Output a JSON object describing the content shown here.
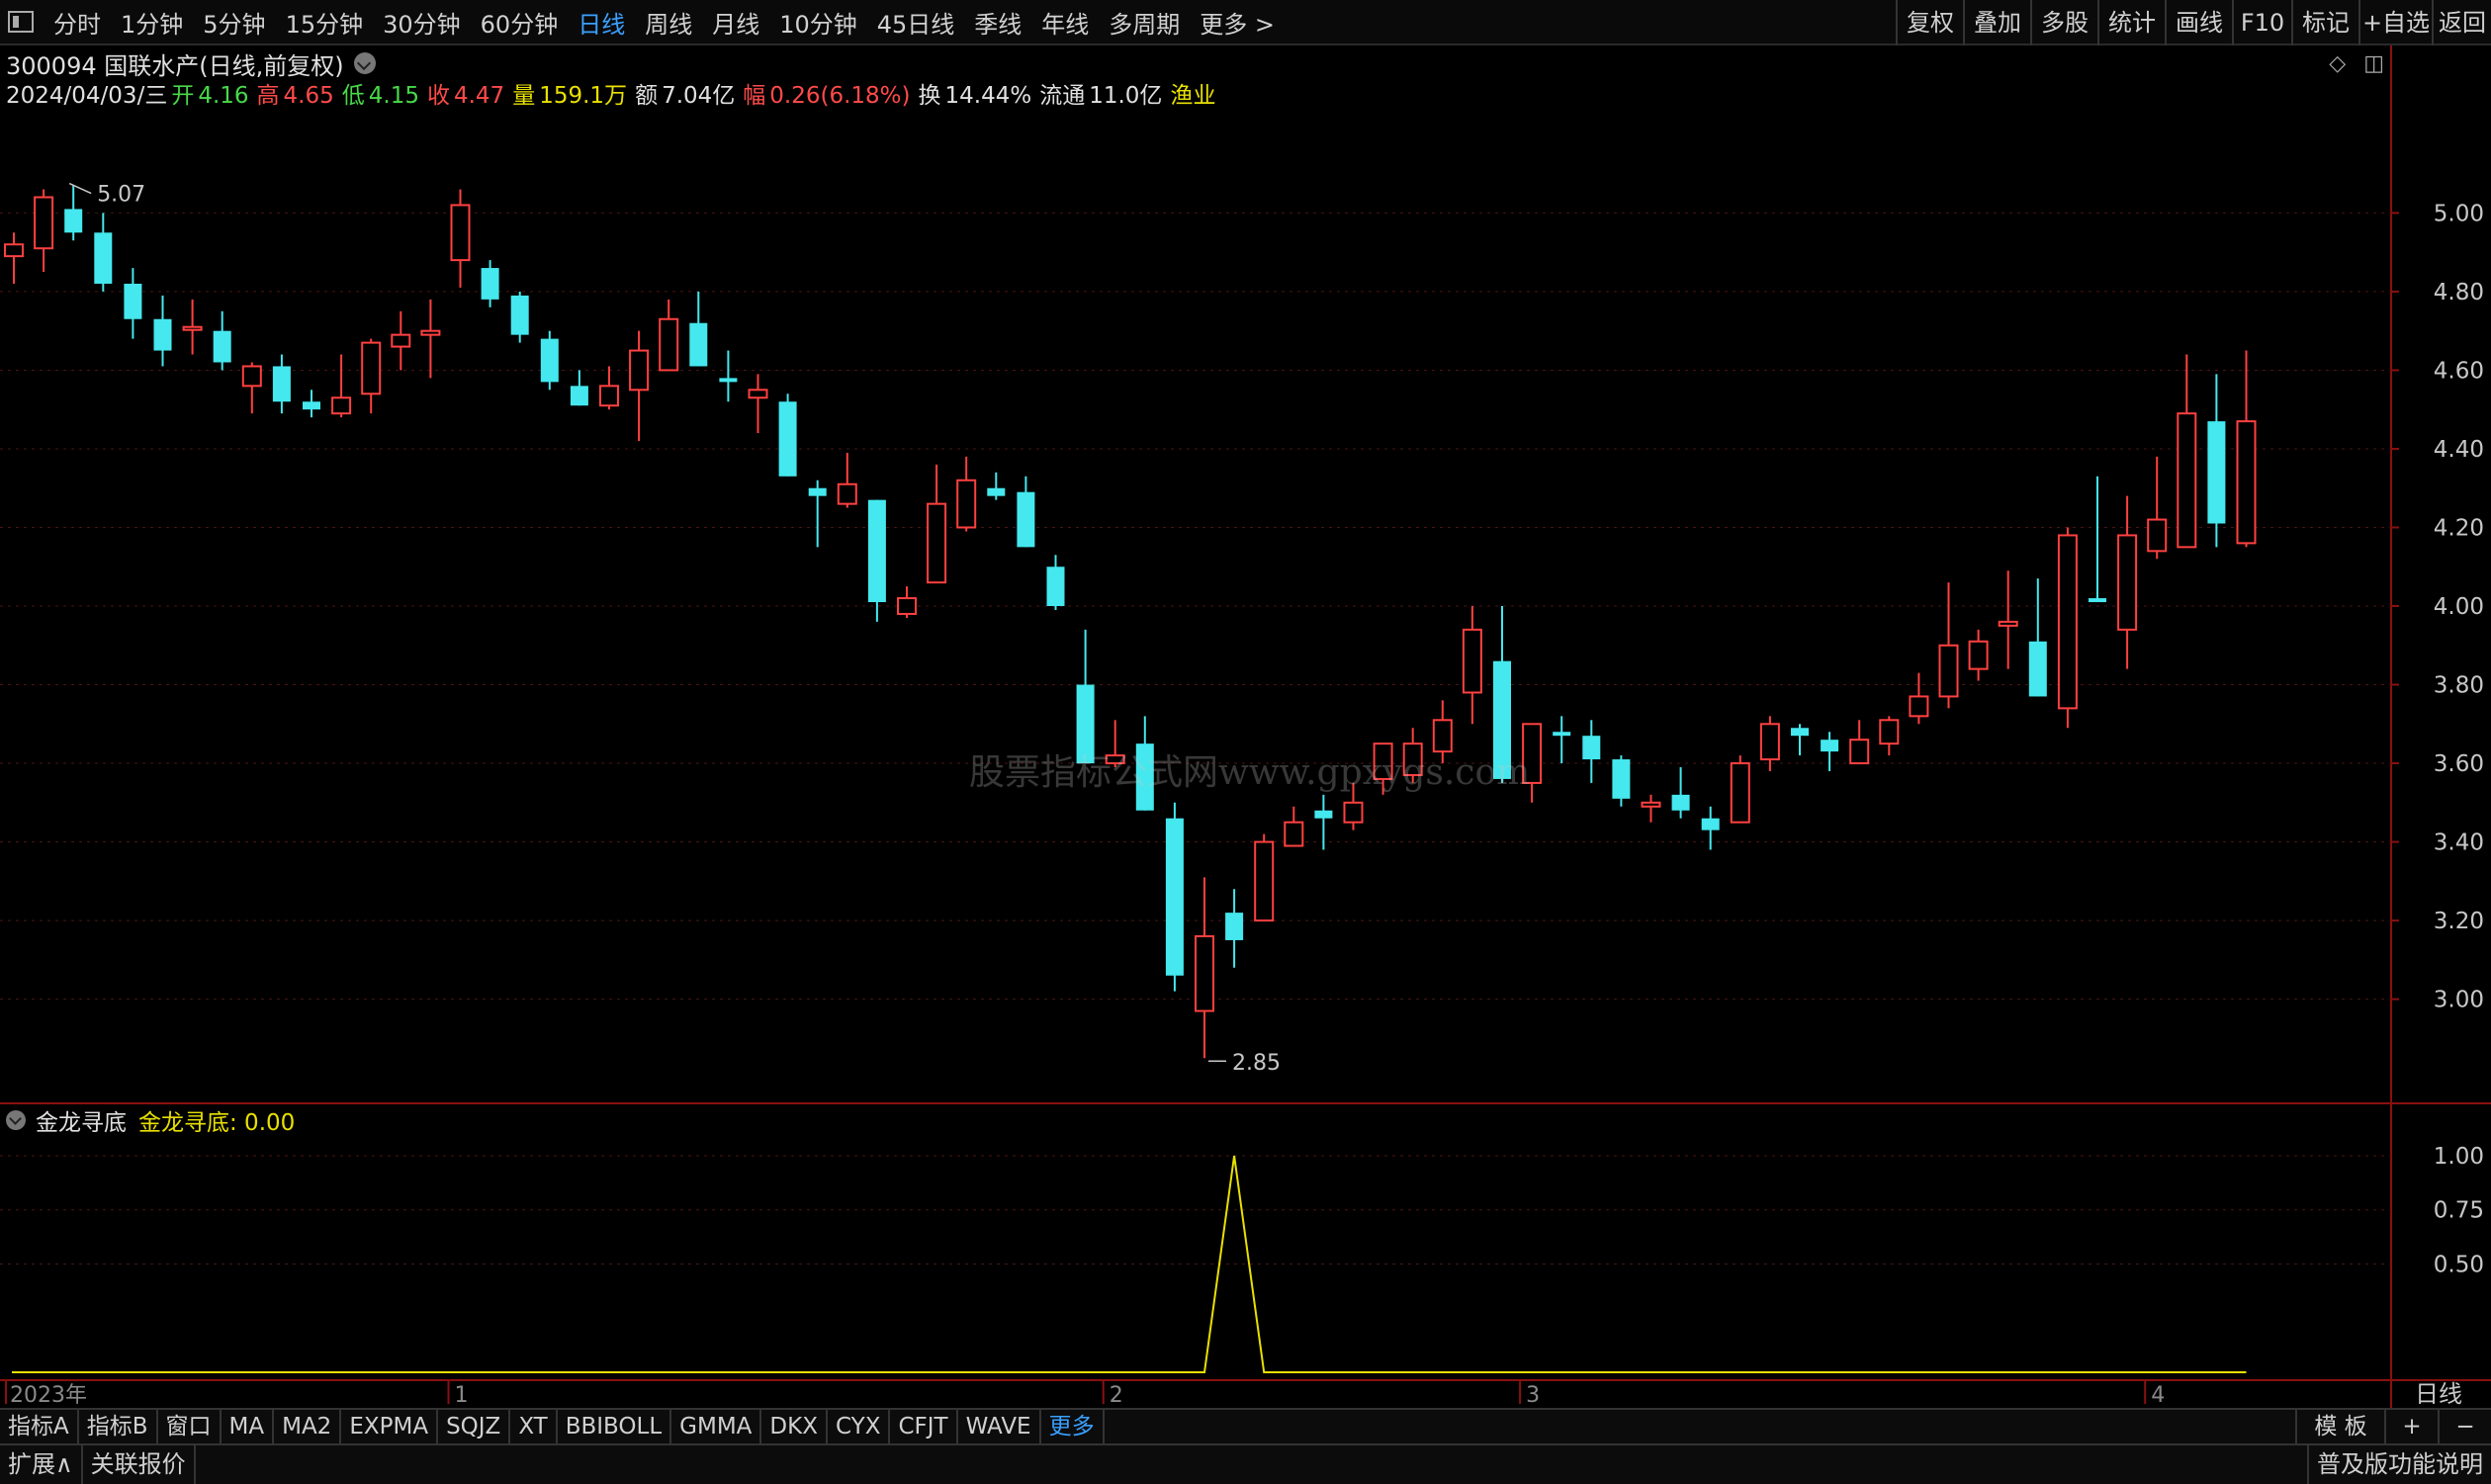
{
  "topbar": {
    "periods": [
      "分时",
      "1分钟",
      "5分钟",
      "15分钟",
      "30分钟",
      "60分钟",
      "日线",
      "周线",
      "月线",
      "10分钟",
      "45日线",
      "季线",
      "年线",
      "多周期",
      "更多 >"
    ],
    "active_period": "日线",
    "right_buttons": [
      "复权",
      "叠加",
      "多股",
      "统计",
      "画线",
      "F10",
      "标记",
      "+自选",
      "返回"
    ]
  },
  "stock": {
    "title": "300094 国联水产(日线,前复权)",
    "date": "2024/04/03/三",
    "open_label": "开",
    "open": "4.16",
    "high_label": "高",
    "high": "4.65",
    "low_label": "低",
    "low": "4.15",
    "close_label": "收",
    "close": "4.47",
    "volume_label": "量",
    "volume": "159.1万",
    "amount_label": "额",
    "amount": "7.04亿",
    "change_label": "幅",
    "change": "0.26(6.18%)",
    "turnover_label": "换",
    "turnover": "14.44%",
    "float_label": "流通",
    "float": "11.0亿",
    "sector": "渔业"
  },
  "panel_icons": [
    "◇",
    "◫"
  ],
  "indicator": {
    "name": "金龙寻底",
    "value_label": "金龙寻底: 0.00"
  },
  "bottom_tabs": [
    "指标A",
    "指标B",
    "窗口",
    "MA",
    "MA2",
    "EXPMA",
    "SQJZ",
    "XT",
    "BBIBOLL",
    "GMMA",
    "DKX",
    "CYX",
    "CFJT",
    "WAVE",
    "更多"
  ],
  "bottom_right": [
    "模 板",
    "+",
    "−"
  ],
  "status": {
    "left": [
      "扩展∧",
      "关联报价"
    ],
    "right": "普及版功能说明"
  },
  "watermark": "股票指标公式网www.gpxygs.com",
  "colors": {
    "up": "#ff4040",
    "down": "#44e8ee",
    "indicator": "#e8e000",
    "grid": "#3a1010",
    "axis": "#c8c8c8",
    "active_tab": "#3aa0ff"
  },
  "chart_data": {
    "type": "candlestick",
    "price_axis": {
      "ticks": [
        "5.00",
        "4.80",
        "4.60",
        "4.40",
        "4.20",
        "4.00",
        "3.80",
        "3.60",
        "3.40",
        "3.20",
        "3.00"
      ],
      "range": [
        2.75,
        5.25
      ]
    },
    "indicator_axis": {
      "ticks": [
        "1.00",
        "0.75",
        "0.50"
      ],
      "range": [
        0,
        1.05
      ]
    },
    "x_labels": [
      "2023年",
      "1",
      "2",
      "3",
      "4"
    ],
    "period_label": "日线",
    "max_marker": "5.07",
    "min_marker": "2.85",
    "candles": [
      [
        4.89,
        4.92,
        4.82,
        4.95
      ],
      [
        4.91,
        5.04,
        5.06,
        4.85
      ],
      [
        5.01,
        4.95,
        5.07,
        4.93
      ],
      [
        4.95,
        4.82,
        5.0,
        4.8
      ],
      [
        4.82,
        4.73,
        4.86,
        4.68
      ],
      [
        4.73,
        4.65,
        4.79,
        4.61
      ],
      [
        4.71,
        4.71,
        4.78,
        4.64
      ],
      [
        4.7,
        4.62,
        4.75,
        4.6
      ],
      [
        4.56,
        4.61,
        4.62,
        4.49
      ],
      [
        4.61,
        4.52,
        4.64,
        4.49
      ],
      [
        4.52,
        4.5,
        4.55,
        4.48
      ],
      [
        4.49,
        4.53,
        4.64,
        4.48
      ],
      [
        4.54,
        4.67,
        4.68,
        4.49
      ],
      [
        4.66,
        4.69,
        4.75,
        4.6
      ],
      [
        4.69,
        4.7,
        4.78,
        4.58
      ],
      [
        4.88,
        5.02,
        5.06,
        4.81
      ],
      [
        4.86,
        4.78,
        4.88,
        4.76
      ],
      [
        4.79,
        4.69,
        4.8,
        4.67
      ],
      [
        4.68,
        4.57,
        4.7,
        4.55
      ],
      [
        4.56,
        4.51,
        4.6,
        4.51
      ],
      [
        4.51,
        4.56,
        4.61,
        4.5
      ],
      [
        4.55,
        4.65,
        4.7,
        4.42
      ],
      [
        4.6,
        4.73,
        4.78,
        4.6
      ],
      [
        4.72,
        4.61,
        4.8,
        4.61
      ],
      [
        4.58,
        4.57,
        4.65,
        4.52
      ],
      [
        4.53,
        4.55,
        4.59,
        4.44
      ],
      [
        4.52,
        4.33,
        4.54,
        4.33
      ],
      [
        4.3,
        4.28,
        4.32,
        4.15
      ],
      [
        4.26,
        4.31,
        4.39,
        4.25
      ],
      [
        4.27,
        4.01,
        4.27,
        3.96
      ],
      [
        3.98,
        4.02,
        4.05,
        3.97
      ],
      [
        4.06,
        4.26,
        4.36,
        4.06
      ],
      [
        4.2,
        4.32,
        4.38,
        4.19
      ],
      [
        4.3,
        4.28,
        4.34,
        4.27
      ],
      [
        4.29,
        4.15,
        4.33,
        4.15
      ],
      [
        4.1,
        4.0,
        4.13,
        3.99
      ],
      [
        3.8,
        3.6,
        3.94,
        3.6
      ],
      [
        3.6,
        3.62,
        3.71,
        3.59
      ],
      [
        3.65,
        3.48,
        3.72,
        3.48
      ],
      [
        3.46,
        3.06,
        3.5,
        3.02
      ],
      [
        2.97,
        3.16,
        3.31,
        2.85
      ],
      [
        3.22,
        3.15,
        3.28,
        3.08
      ],
      [
        3.2,
        3.4,
        3.42,
        3.2
      ],
      [
        3.39,
        3.45,
        3.49,
        3.45
      ],
      [
        3.48,
        3.46,
        3.52,
        3.38
      ],
      [
        3.45,
        3.5,
        3.55,
        3.43
      ],
      [
        3.56,
        3.65,
        3.64,
        3.52
      ],
      [
        3.57,
        3.65,
        3.69,
        3.55
      ],
      [
        3.63,
        3.71,
        3.76,
        3.6
      ],
      [
        3.78,
        3.94,
        4.0,
        3.7
      ],
      [
        3.86,
        3.56,
        4.0,
        3.55
      ],
      [
        3.55,
        3.7,
        3.66,
        3.5
      ],
      [
        3.68,
        3.67,
        3.72,
        3.6
      ],
      [
        3.67,
        3.61,
        3.71,
        3.55
      ],
      [
        3.61,
        3.51,
        3.62,
        3.49
      ],
      [
        3.49,
        3.5,
        3.52,
        3.45
      ],
      [
        3.52,
        3.48,
        3.59,
        3.46
      ],
      [
        3.46,
        3.43,
        3.49,
        3.38
      ],
      [
        3.45,
        3.6,
        3.62,
        3.45
      ],
      [
        3.61,
        3.7,
        3.72,
        3.58
      ],
      [
        3.69,
        3.67,
        3.7,
        3.62
      ],
      [
        3.66,
        3.63,
        3.68,
        3.58
      ],
      [
        3.6,
        3.66,
        3.71,
        3.6
      ],
      [
        3.65,
        3.71,
        3.72,
        3.62
      ],
      [
        3.72,
        3.77,
        3.83,
        3.7
      ],
      [
        3.77,
        3.9,
        4.06,
        3.74
      ],
      [
        3.84,
        3.91,
        3.94,
        3.81
      ],
      [
        3.95,
        3.96,
        4.09,
        3.84
      ],
      [
        3.91,
        3.77,
        4.07,
        3.77
      ],
      [
        3.74,
        4.18,
        4.2,
        3.69
      ],
      [
        4.02,
        4.01,
        4.33,
        4.01
      ],
      [
        3.94,
        4.18,
        4.28,
        3.84
      ],
      [
        4.14,
        4.22,
        4.38,
        4.12
      ],
      [
        4.15,
        4.49,
        4.64,
        4.15
      ],
      [
        4.47,
        4.21,
        4.59,
        4.15
      ],
      [
        4.16,
        4.47,
        4.65,
        4.15
      ]
    ],
    "indicator_values": {
      "baseline": 0.0,
      "peak": 1.0,
      "peak_candle_index": 41
    }
  }
}
